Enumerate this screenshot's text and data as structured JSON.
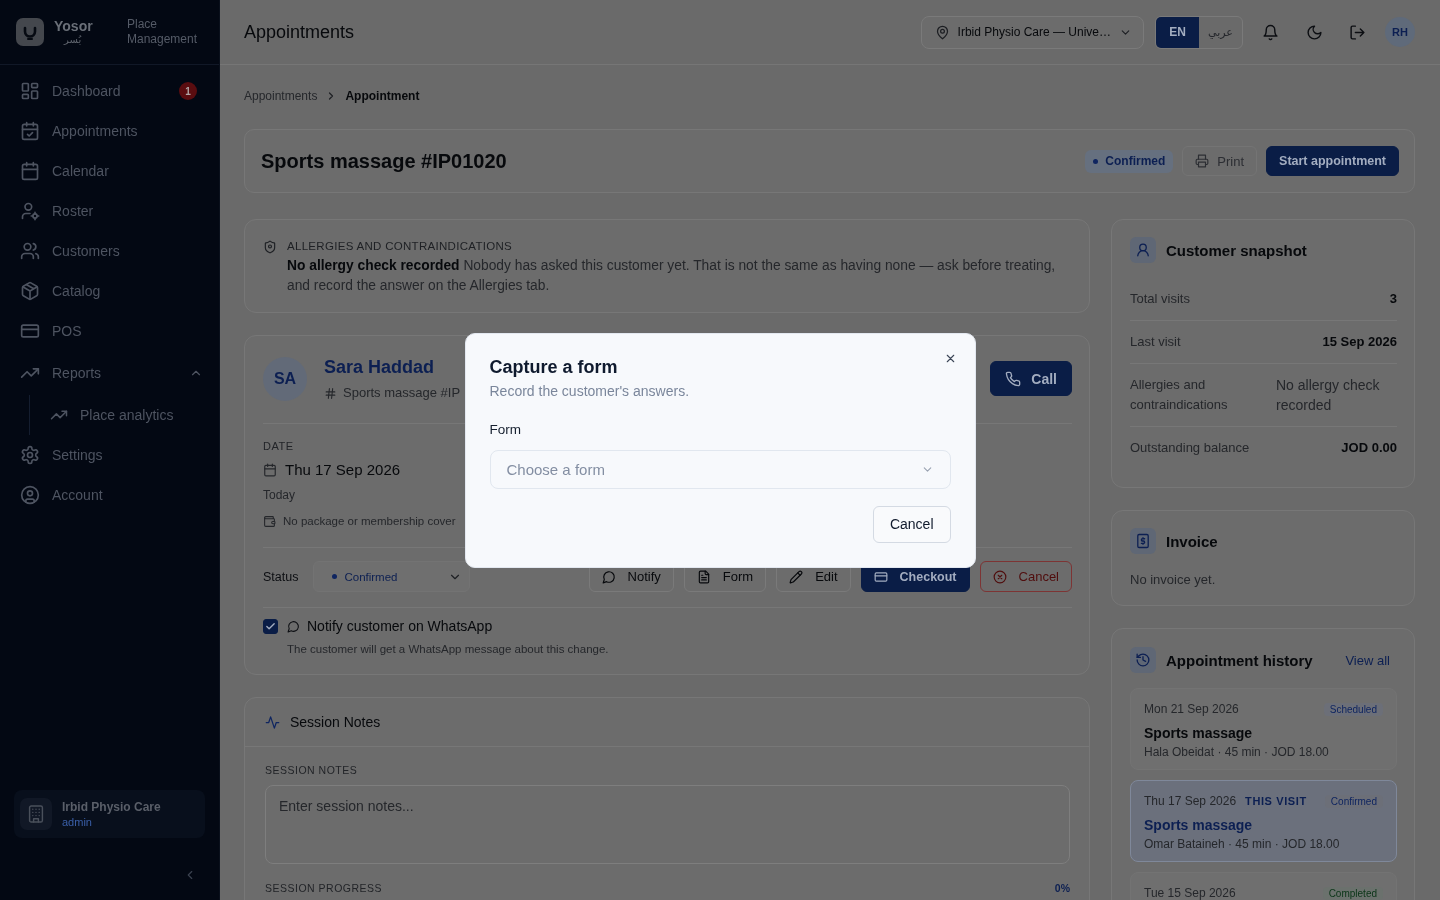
{
  "sidebar": {
    "brand": {
      "name": "Yosor",
      "name_ar": "يُسر",
      "subtitle": "Place Management"
    },
    "items": [
      {
        "label": "Dashboard",
        "selected": false,
        "badge": "1"
      },
      {
        "label": "Appointments",
        "selected": false
      },
      {
        "label": "Calendar",
        "selected": false
      },
      {
        "label": "Roster",
        "selected": false
      },
      {
        "label": "Customers",
        "selected": false
      },
      {
        "label": "Catalog",
        "selected": false
      },
      {
        "label": "POS",
        "selected": false
      },
      {
        "label": "Reports",
        "selected": false,
        "expanded": true,
        "children": [
          {
            "label": "Place analytics",
            "selected": false
          }
        ]
      },
      {
        "label": "Settings",
        "selected": false
      },
      {
        "label": "Account",
        "selected": false
      }
    ],
    "footer": {
      "place": "Irbid Physio Care",
      "role": "admin"
    }
  },
  "top_bar": {
    "title": "Appointments",
    "location": "Irbid Physio Care — Unive…",
    "languages": [
      {
        "label": "EN",
        "selected": true
      },
      {
        "label": "عربي",
        "selected": false
      }
    ],
    "avatar": "RH"
  },
  "breadcrumb": [
    "Appointments",
    "Appointment"
  ],
  "title_bar": {
    "title": "Sports massage #IP01020",
    "status": "Confirmed",
    "actions": [
      {
        "label": "Print",
        "kind": "outline",
        "disabled": true
      },
      {
        "label": "Start appointment",
        "kind": "primary",
        "disabled": false
      }
    ]
  },
  "allergy_alert": {
    "heading": "ALLERGIES AND CONTRAINDICATIONS",
    "message": "**No allergy check recorded** Nobody has asked this customer yet. That is not the same as having none — ask before treating, and record the answer on the Allergies tab."
  },
  "appointment": {
    "initials": "SA",
    "customer": "Sara Haddad",
    "reference": "Sports massage #IP",
    "call": "Call",
    "date_label": "DATE",
    "date": "Thu 17 Sep 2026",
    "date_note": "Today",
    "package_note": "No package or membership cover",
    "status_label": "Status",
    "status": "Confirmed",
    "actions": [
      {
        "label": "Notify",
        "kind": "outline"
      },
      {
        "label": "Form",
        "kind": "outline"
      },
      {
        "label": "Edit",
        "kind": "outline"
      },
      {
        "label": "Checkout",
        "kind": "primary"
      },
      {
        "label": "Cancel",
        "kind": "danger"
      }
    ],
    "notify": {
      "label": "Notify customer on WhatsApp",
      "checked": true,
      "hint": "The customer will get a WhatsApp message about this change."
    }
  },
  "session_notes": {
    "title": "Session Notes",
    "notes_label": "SESSION NOTES",
    "placeholder": "Enter session notes...",
    "progress_label": "SESSION PROGRESS",
    "progress_value": "0%"
  },
  "customer_snapshot": {
    "title": "Customer snapshot",
    "rows": [
      {
        "label": "Total visits",
        "value": "3",
        "kind": "value"
      },
      {
        "label": "Last visit",
        "value": "15 Sep 2026",
        "kind": "value"
      },
      {
        "label": "Allergies and contraindications",
        "value": "No allergy check recorded",
        "kind": "note"
      },
      {
        "label": "Outstanding balance",
        "value": "JOD 0.00",
        "kind": "value"
      }
    ]
  },
  "invoice": {
    "title": "Invoice",
    "empty": "No invoice yet."
  },
  "appointment_history": {
    "title": "Appointment history",
    "link": "View all",
    "items": [
      {
        "date": "Mon 21 Sep 2026",
        "status": "Scheduled",
        "color": "#0f2560",
        "service": "Sports massage",
        "details": "Hala Obeidat · 45 min · JOD 18.00",
        "current": false
      },
      {
        "date": "Thu 17 Sep 2026",
        "tag": "THIS VISIT",
        "status": "Confirmed",
        "color": "#0f2560",
        "service": "Sports massage",
        "details": "Omar Bataineh · 45 min · JOD 18.00",
        "current": true
      },
      {
        "date": "Tue 15 Sep 2026",
        "status": "Completed",
        "color": "#0a3517",
        "current": false
      }
    ]
  },
  "dialog": {
    "title": "Capture a form",
    "subtitle": "Record the customer's answers.",
    "field_label": "Form",
    "placeholder": "Choose a form",
    "buttons": [
      {
        "label": "Cancel"
      }
    ]
  }
}
